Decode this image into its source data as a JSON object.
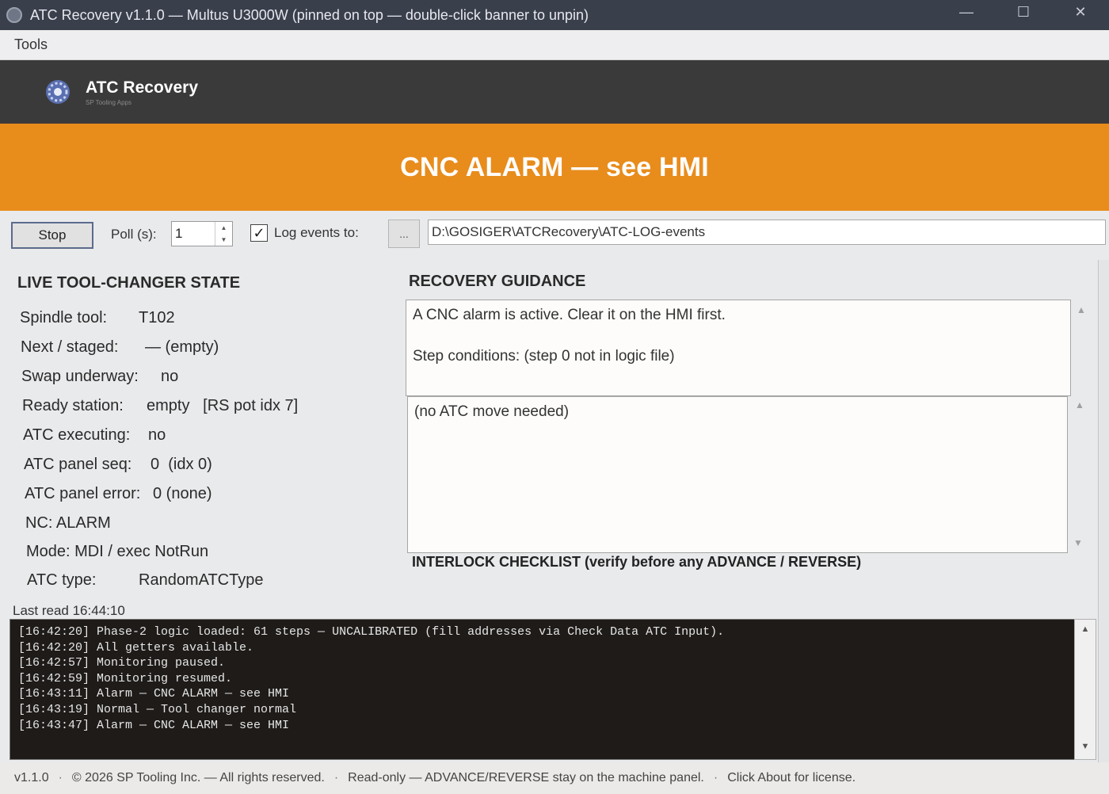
{
  "window": {
    "title": "ATC Recovery v1.1.0 — Multus U3000W   (pinned on top — double-click banner to unpin)",
    "minimize": "—",
    "maximize": "☐",
    "close": "✕"
  },
  "menu": {
    "tools": "Tools"
  },
  "header": {
    "app_name": "ATC Recovery",
    "subtitle": "SP Tooling Apps"
  },
  "banner": {
    "text": "CNC ALARM — see HMI",
    "color": "#e88c1c"
  },
  "toolbar": {
    "stop_label": "Stop",
    "poll_label": "Poll (s):",
    "poll_value": "1",
    "log_checked": true,
    "log_label": "Log events to:",
    "browse_label": "...",
    "log_path": "D:\\GOSIGER\\ATCRecovery\\ATC-LOG-events"
  },
  "state": {
    "heading": "LIVE TOOL-CHANGER STATE",
    "rows": [
      {
        "label": "Spindle tool:",
        "value": "T102"
      },
      {
        "label": "Next / staged:",
        "value": "— (empty)"
      },
      {
        "label": "Swap underway:",
        "value": "no"
      },
      {
        "label": "Ready station:",
        "value": "empty   [RS pot idx 7]"
      },
      {
        "label": "ATC executing:",
        "value": "no"
      },
      {
        "label": "ATC panel seq:",
        "value": "0  (idx 0)"
      },
      {
        "label": "ATC panel error:",
        "value": "0 (none)"
      },
      {
        "label": "NC: ALARM",
        "value": ""
      },
      {
        "label": "Mode: MDI / exec NotRun",
        "value": ""
      },
      {
        "label": "ATC type:",
        "value": "RandomATCType"
      }
    ],
    "last_read": "Last read 16:44:10"
  },
  "guidance": {
    "heading": "RECOVERY GUIDANCE",
    "message": "A CNC alarm is active. Clear it on the HMI first.",
    "step_conditions": "Step conditions: (step 0 not in logic file)",
    "move": "(no ATC move needed)",
    "interlock_heading": "INTERLOCK CHECKLIST (verify before any ADVANCE / REVERSE)"
  },
  "log": {
    "lines": [
      "[16:42:20] Phase-2 logic loaded: 61 steps — UNCALIBRATED (fill addresses via Check Data ATC Input).",
      "[16:42:20] All getters available.",
      "[16:42:57] Monitoring paused.",
      "[16:42:59] Monitoring resumed.",
      "[16:43:11] Alarm — CNC ALARM — see HMI",
      "[16:43:19] Normal — Tool changer normal",
      "[16:43:47] Alarm — CNC ALARM — see HMI"
    ]
  },
  "status": {
    "version": "v1.1.0",
    "copyright": "© 2026 SP Tooling Inc. — All rights reserved.",
    "readonly": "Read-only — ADVANCE/REVERSE stay on the machine panel.",
    "license": "Click About for license."
  }
}
